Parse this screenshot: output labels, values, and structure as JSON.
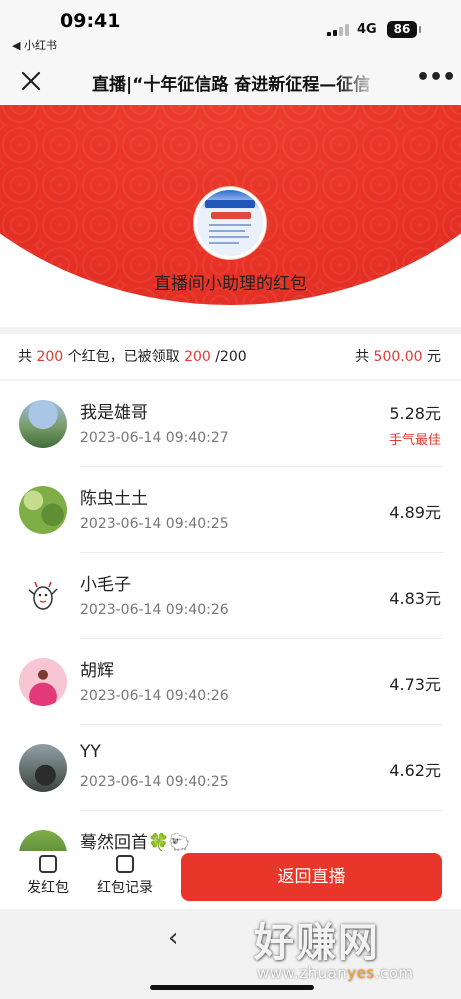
{
  "status_bar": {
    "time": "09:41",
    "back_app": "◀ 小红书",
    "network": "4G",
    "battery": "86"
  },
  "nav": {
    "title": "直播|“十年征信路 奋进新征程—征信",
    "more": "•••"
  },
  "header": {
    "title": "直播间小助理的红包",
    "accent_color": "#e8372a"
  },
  "summary": {
    "prefix": "共 ",
    "count": "200",
    "mid": " 个红包，已被领取 ",
    "received": "200",
    "total_count": " /200",
    "amount_prefix": "共 ",
    "amount": "500.00",
    "amount_suffix": " 元"
  },
  "records": [
    {
      "name": "我是雄哥",
      "time": "2023-06-14 09:40:27",
      "amount": "5.28元",
      "badge": "手气最佳"
    },
    {
      "name": "陈虫土土",
      "time": "2023-06-14 09:40:25",
      "amount": "4.89元",
      "badge": ""
    },
    {
      "name": "小毛子",
      "time": "2023-06-14 09:40:26",
      "amount": "4.83元",
      "badge": ""
    },
    {
      "name": "胡辉",
      "time": "2023-06-14 09:40:26",
      "amount": "4.73元",
      "badge": ""
    },
    {
      "name": "YY",
      "time": "2023-06-14 09:40:25",
      "amount": "4.62元",
      "badge": ""
    },
    {
      "name": "蓦然回首🍀🐑",
      "time": "",
      "amount": "",
      "badge": ""
    }
  ],
  "actions": {
    "send": "发红包",
    "history": "红包记录",
    "back_live": "返回直播"
  },
  "watermark": {
    "text": "好赚网",
    "url_a": "www.zhuan",
    "url_b": "yes",
    "url_c": ".com"
  }
}
